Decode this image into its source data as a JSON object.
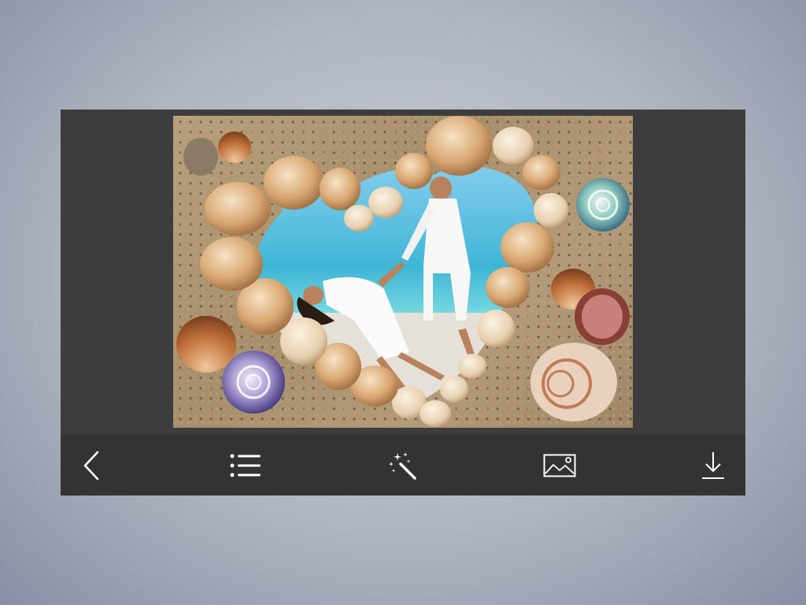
{
  "app": {
    "background_color": "#b0b8c4",
    "panel_color": "#3c3c3c",
    "toolbar_color": "#333333"
  },
  "photo": {
    "subject": "couple-on-beach-in-seashell-heart-frame"
  },
  "toolbar": {
    "items": [
      {
        "name": "back",
        "icon": "chevron-left-icon"
      },
      {
        "name": "frames-list",
        "icon": "list-icon"
      },
      {
        "name": "effects",
        "icon": "magic-wand-icon"
      },
      {
        "name": "gallery",
        "icon": "image-icon"
      },
      {
        "name": "save",
        "icon": "download-icon"
      }
    ]
  }
}
